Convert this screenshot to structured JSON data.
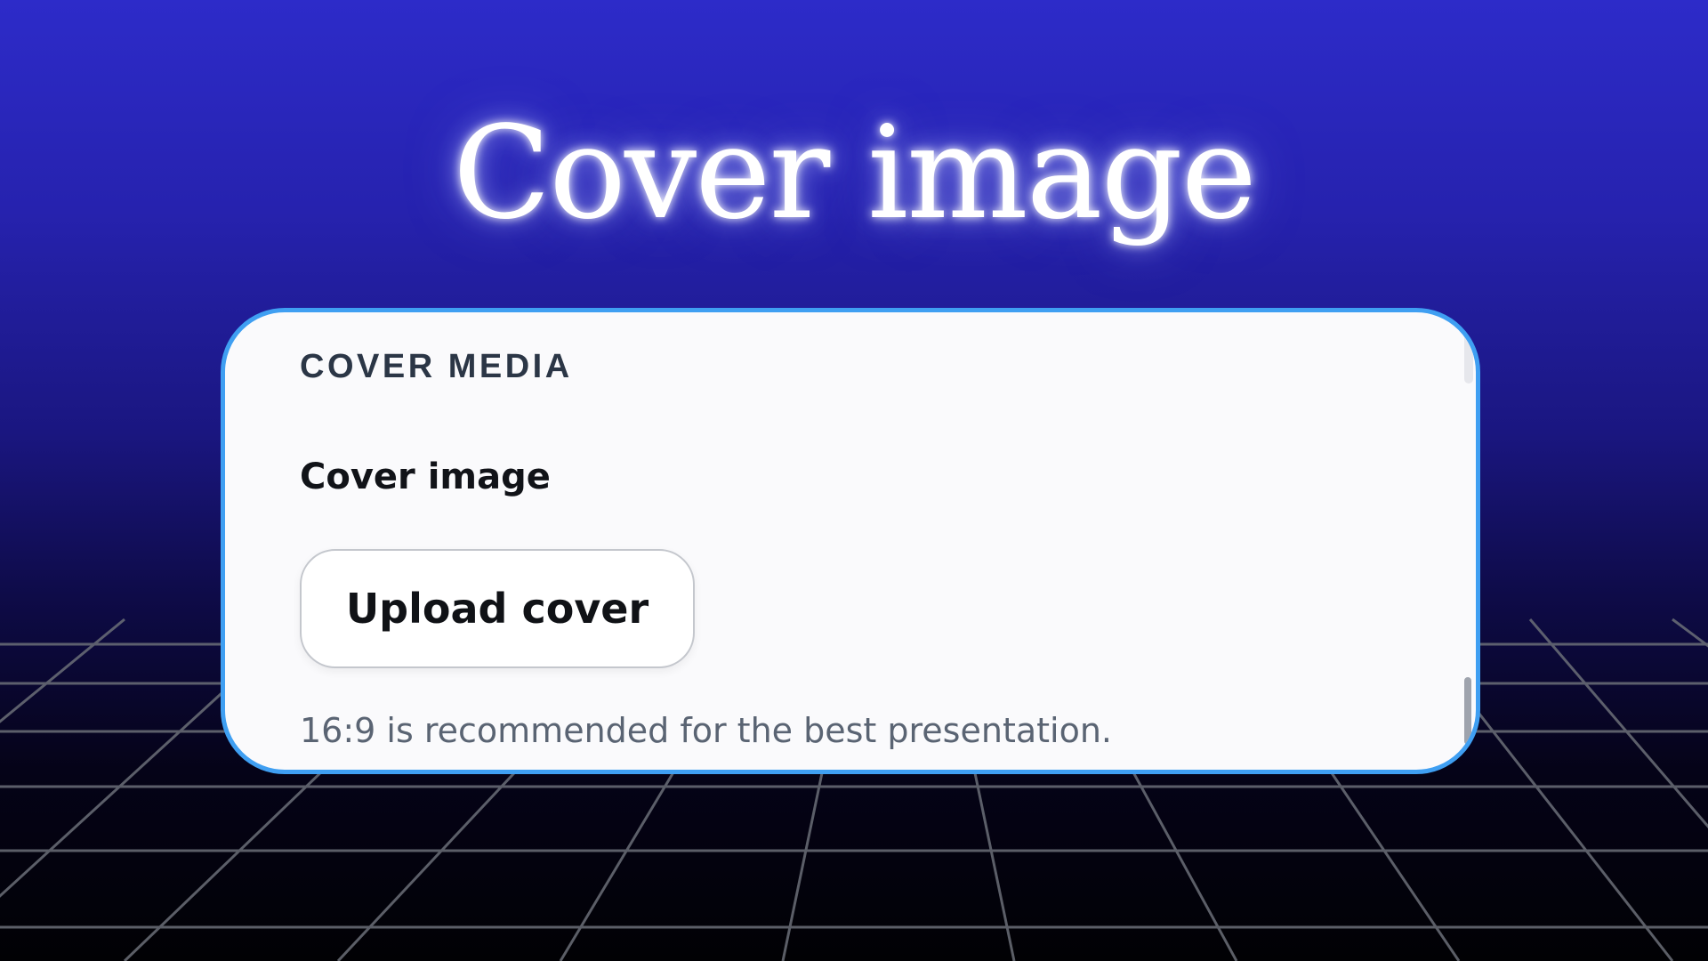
{
  "hero": {
    "title": "Cover image"
  },
  "panel": {
    "section_heading": "COVER MEDIA",
    "field_label": "Cover image",
    "upload_button_label": "Upload cover",
    "helper_text": "16:9 is recommended for the best presentation."
  },
  "colors": {
    "background_top": "#2d2bc9",
    "background_bottom": "#010104",
    "card_border": "#3f9ff2",
    "card_background": "#fafafc",
    "grid_lines": "#6b6f78"
  }
}
